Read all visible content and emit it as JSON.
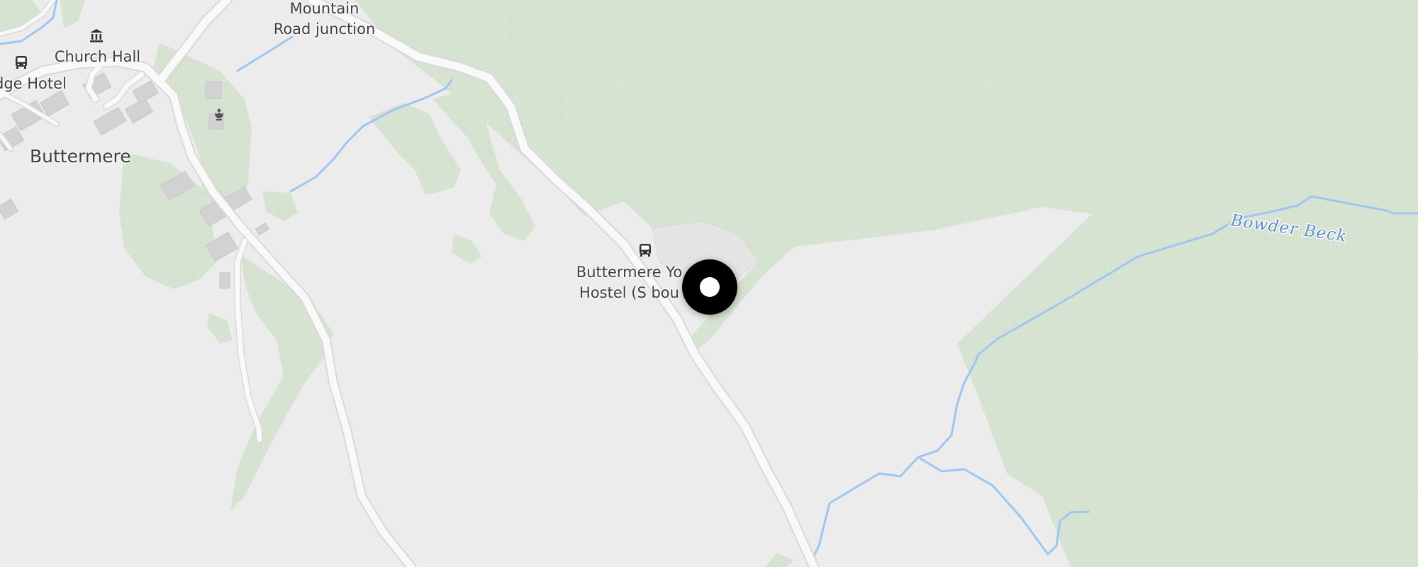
{
  "map": {
    "colors": {
      "land": "#ececec",
      "vegetation": "#d8e4d3",
      "vegetation_dark": "#cbdcc6",
      "water": "#9fc6f0",
      "road": "#f9f9f9",
      "road_edge": "#d9d9d9",
      "building": "#d2d2d2",
      "marker": "#000000"
    },
    "places": {
      "village": "Buttermere"
    },
    "pois": {
      "bus_stop_hostel": {
        "label": "Buttermere Yo\nHostel (S bou",
        "icon": "bus-stop-icon"
      },
      "bus_stop_junction": {
        "label": "Mountain\nRoad junction",
        "icon": "bus-stop-icon"
      },
      "church_hall": {
        "label": "Church Hall",
        "icon": "town-hall-icon"
      },
      "hotel": {
        "label": "dge Hotel",
        "icon": "bus-stop-icon"
      },
      "memorial": {
        "icon": "memorial-icon"
      }
    },
    "waterways": {
      "beck": "Bowder Beck"
    },
    "marker": {
      "icon": "current-location-marker"
    }
  }
}
